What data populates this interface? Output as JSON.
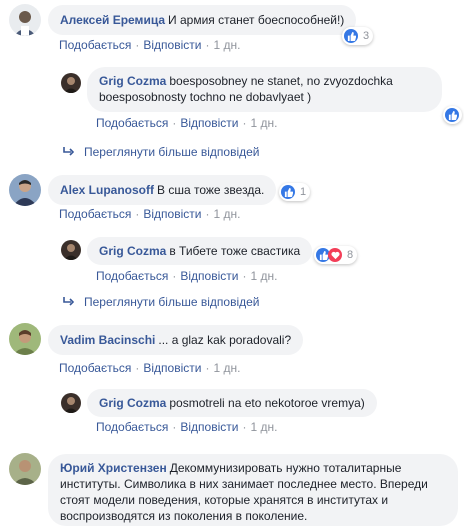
{
  "actions": {
    "like": "Подобається",
    "reply": "Відповісти",
    "time": "1 дн."
  },
  "more_replies": "Переглянути більше відповідей",
  "comments": [
    {
      "author": "Алексей Еремица",
      "text": "И армия станет боеспособней!)",
      "reactions": "3"
    },
    {
      "author": "Grig Cozma",
      "text": "boesposobney ne stanet, no zvyozdochka",
      "text2": "boesposobnosty tochno ne dobavlyaet )"
    },
    {
      "author": "Alex Lupanosoff",
      "text": "В сша тоже звезда.",
      "reactions": "1"
    },
    {
      "author": "Grig Cozma",
      "text": "в Тибете тоже свастика",
      "reactions": "8"
    },
    {
      "author": "Vadim Bacinschi",
      "text": "... a glaz kak poradovali?"
    },
    {
      "author": "Grig Cozma",
      "text": "posmotreli na eto nekotoroe vremya)"
    },
    {
      "author": "Юрий Христензен",
      "text": "Декоммунизировать нужно тоталитарные",
      "text2": "институты. Символика в них занимает последнее место. Впереди",
      "text3": "стоят модели поведения, которые хранятся в институтах и",
      "text4": "воспроизводятся из поколения в поколение."
    }
  ]
}
